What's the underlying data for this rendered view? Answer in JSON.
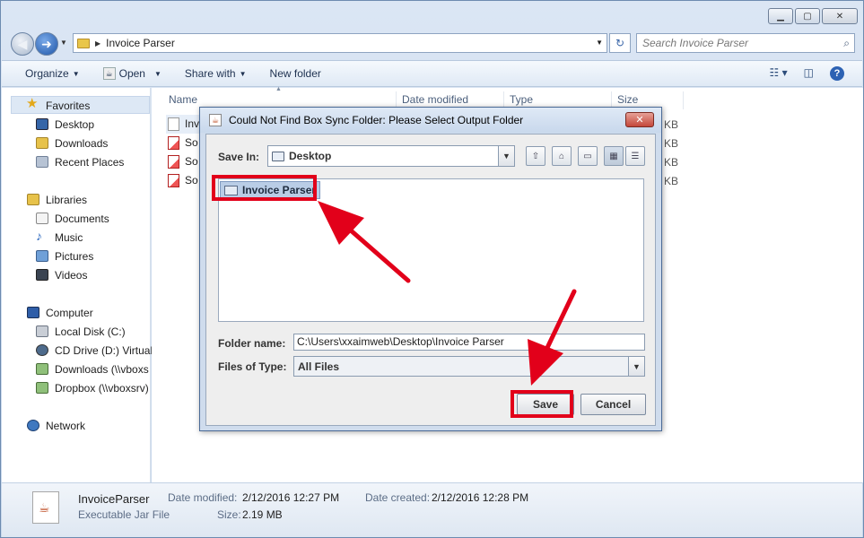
{
  "window": {
    "minimize": "▁",
    "maximize": "▢",
    "close": "✕"
  },
  "navbar": {
    "address": "Invoice Parser",
    "search_placeholder": "Search Invoice Parser"
  },
  "toolbar": {
    "organize": "Organize",
    "open": "Open",
    "share_with": "Share with",
    "new_folder": "New folder"
  },
  "sidebar": {
    "favorites": "Favorites",
    "desktop": "Desktop",
    "downloads": "Downloads",
    "recent_places": "Recent Places",
    "libraries": "Libraries",
    "documents": "Documents",
    "music": "Music",
    "pictures": "Pictures",
    "videos": "Videos",
    "computer": "Computer",
    "local_disk": "Local Disk (C:)",
    "cd_drive": "CD Drive (D:) Virtual",
    "downloads_share": "Downloads (\\\\vboxs",
    "dropbox_share": "Dropbox (\\\\vboxsrv)",
    "network": "Network"
  },
  "columns": {
    "name": "Name",
    "date_modified": "Date modified",
    "type": "Type",
    "size": "Size"
  },
  "files": [
    {
      "name": "Inv",
      "size": "KB"
    },
    {
      "name": "So",
      "size": "KB"
    },
    {
      "name": "So",
      "size": "KB"
    },
    {
      "name": "So",
      "size": "KB"
    }
  ],
  "status": {
    "name": "InvoiceParser",
    "type": "Executable Jar File",
    "date_modified_label": "Date modified:",
    "date_modified": "2/12/2016 12:27 PM",
    "date_created_label": "Date created:",
    "date_created": "2/12/2016 12:28 PM",
    "size_label": "Size:",
    "size": "2.19 MB"
  },
  "dialog": {
    "title": "Could Not Find Box Sync Folder: Please Select Output Folder",
    "close": "✕",
    "save_in_label": "Save In:",
    "save_in_value": "Desktop",
    "list_item": "Invoice Parser",
    "folder_name_label": "Folder name:",
    "folder_name_value": "C:\\Users\\xxaimweb\\Desktop\\Invoice Parser",
    "files_of_type_label": "Files of Type:",
    "files_of_type_value": "All Files",
    "save_button": "Save",
    "cancel_button": "Cancel"
  },
  "colors": {
    "highlight": "#e2001a",
    "arrow": "#e2001a"
  }
}
